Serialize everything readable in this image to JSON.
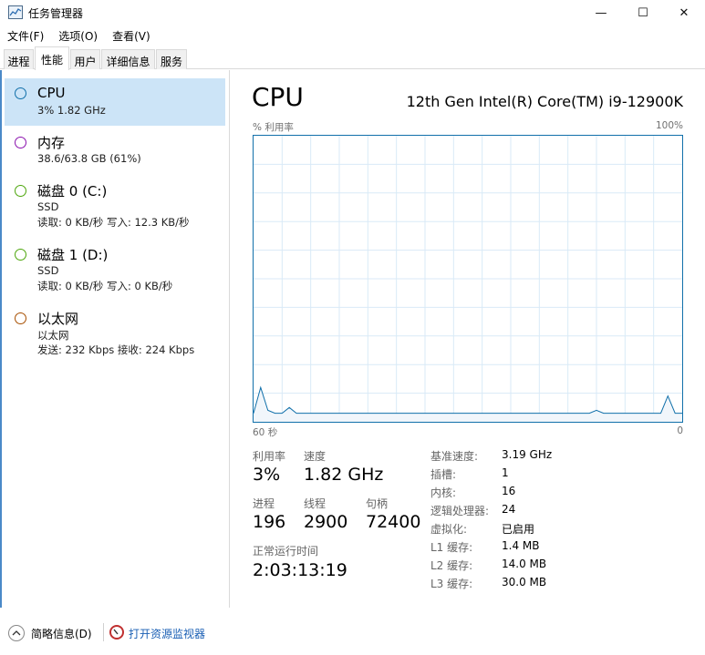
{
  "window": {
    "title": "任务管理器",
    "minimize": "—",
    "maximize": "☐",
    "close": "✕"
  },
  "menu": [
    "文件(F)",
    "选项(O)",
    "查看(V)"
  ],
  "tabs": [
    {
      "label": "进程",
      "active": false
    },
    {
      "label": "性能",
      "active": true
    },
    {
      "label": "用户",
      "active": false
    },
    {
      "label": "详细信息",
      "active": false
    },
    {
      "label": "服务",
      "active": false
    }
  ],
  "resources": [
    {
      "title": "CPU",
      "lines": [
        "3%  1.82 GHz"
      ],
      "color": "#1170aa",
      "selected": true
    },
    {
      "title": "内存",
      "lines": [
        "38.6/63.8 GB (61%)"
      ],
      "color": "#8b12ae",
      "selected": false
    },
    {
      "title": "磁盘 0 (C:)",
      "lines": [
        "SSD",
        "读取: 0 KB/秒  写入: 12.3 KB/秒"
      ],
      "color": "#4da60c",
      "selected": false
    },
    {
      "title": "磁盘 1 (D:)",
      "lines": [
        "SSD",
        "读取: 0 KB/秒  写入: 0 KB/秒"
      ],
      "color": "#4da60c",
      "selected": false
    },
    {
      "title": "以太网",
      "lines": [
        "以太网",
        "发送: 232 Kbps  接收: 224 Kbps"
      ],
      "color": "#a74f01",
      "selected": false
    }
  ],
  "detail": {
    "title": "CPU",
    "model": "12th Gen Intel(R) Core(TM) i9-12900K",
    "graph": {
      "top_left": "% 利用率",
      "top_right": "100%",
      "bottom_left": "60 秒",
      "bottom_right": "0",
      "line_color": "#1170aa",
      "grid_color": "#d9eaf7"
    },
    "stats": {
      "utilization_label": "利用率",
      "utilization": "3%",
      "speed_label": "速度",
      "speed": "1.82 GHz",
      "processes_label": "进程",
      "processes": "196",
      "threads_label": "线程",
      "threads": "2900",
      "handles_label": "句柄",
      "handles": "72400",
      "uptime_label": "正常运行时间",
      "uptime": "2:03:13:19"
    },
    "specs": [
      {
        "key": "基准速度:",
        "value": "3.19 GHz"
      },
      {
        "key": "插槽:",
        "value": "1"
      },
      {
        "key": "内核:",
        "value": "16"
      },
      {
        "key": "逻辑处理器:",
        "value": "24"
      },
      {
        "key": "虚拟化:",
        "value": "已启用"
      },
      {
        "key": "L1 缓存:",
        "value": "1.4 MB"
      },
      {
        "key": "L2 缓存:",
        "value": "14.0 MB"
      },
      {
        "key": "L3 缓存:",
        "value": "30.0 MB"
      }
    ]
  },
  "chart_data": {
    "type": "area",
    "x": [
      60,
      59,
      58,
      57,
      56,
      55,
      54,
      53,
      52,
      51,
      50,
      49,
      48,
      47,
      46,
      45,
      44,
      43,
      42,
      41,
      40,
      39,
      38,
      37,
      36,
      35,
      34,
      33,
      32,
      31,
      30,
      29,
      28,
      27,
      26,
      25,
      24,
      23,
      22,
      21,
      20,
      19,
      18,
      17,
      16,
      15,
      14,
      13,
      12,
      11,
      10,
      9,
      8,
      7,
      6,
      5,
      4,
      3,
      2,
      1,
      0
    ],
    "values": [
      3,
      12,
      4,
      3,
      3,
      5,
      3,
      3,
      3,
      3,
      3,
      3,
      3,
      3,
      3,
      3,
      3,
      3,
      3,
      3,
      3,
      3,
      3,
      3,
      3,
      3,
      3,
      3,
      3,
      3,
      3,
      3,
      3,
      3,
      3,
      3,
      3,
      3,
      3,
      3,
      3,
      3,
      3,
      3,
      3,
      3,
      3,
      3,
      4,
      3,
      3,
      3,
      3,
      3,
      3,
      3,
      3,
      3,
      9,
      3,
      3
    ],
    "ylim": [
      0,
      100
    ],
    "xlim": [
      60,
      0
    ],
    "grid": true
  },
  "bottom": {
    "fewer_details": "简略信息(D)",
    "resource_monitor": "打开资源监视器"
  }
}
